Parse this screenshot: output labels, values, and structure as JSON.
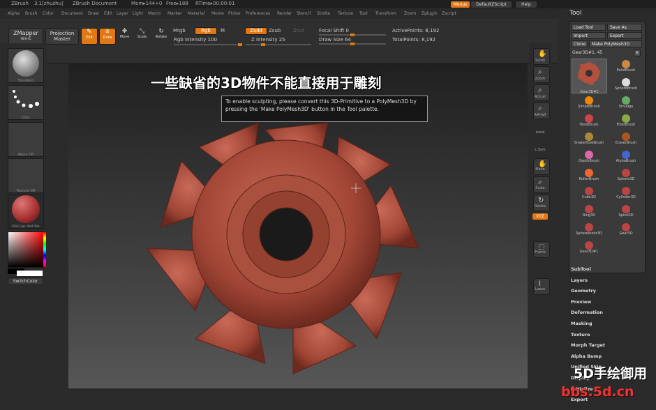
{
  "title_bar": {
    "app": "ZBrush",
    "version": "3.1[zhuzhu]",
    "doc": "ZBrush Document",
    "mem": "Mem▸144+0",
    "free": "Free▸188",
    "rtime": "RTime▸00:00:01",
    "menus_btn": "Menus",
    "script_btn": "DefaultZScript",
    "help_btn": "Help"
  },
  "menu_items": [
    "Alpha",
    "Brush",
    "Color",
    "Document",
    "Draw",
    "Edit",
    "Layer",
    "Light",
    "Macro",
    "Marker",
    "Material",
    "Movie",
    "Picker",
    "Preferences",
    "Render",
    "Stencil",
    "Stroke",
    "Texture",
    "Tool",
    "Transform",
    "Zoom",
    "Zplugin",
    "Zscript"
  ],
  "toolbar": {
    "zmapper": "ZMapper",
    "zmapper_sub": "rev-E",
    "projection": "Projection",
    "projection_sub": "Master",
    "edit": "Edit",
    "draw": "Draw",
    "move": "Move",
    "scale": "Scale",
    "rotate": "Rotate",
    "mrgb": "Mrgb",
    "rgb": "Rgb",
    "m": "M",
    "zadd": "Zadd",
    "zsub": "Zsub",
    "zcut": "Zcut",
    "rgb_intensity": "Rgb Intensity 100",
    "z_intensity": "Z Intensity 25",
    "focal_shift": "Focal Shift 0",
    "draw_size": "Draw Size 64",
    "active_points": "ActivePoints: 8,192",
    "total_points": "TotalPoints: 8,192"
  },
  "left_panel": [
    "Standard",
    "Dots",
    "Alpha Off",
    "Texture Off",
    "MatCap Red Wa"
  ],
  "switch_color": "SwitchColor",
  "viewport": {
    "overlay_title": "一些缺省的3D物件不能直接用于雕刻",
    "notice": "To enable sculpting, please convert this 3D-Primitive to a PolyMesh3D by pressing the 'Make PolyMesh3D' button in the Tool palette."
  },
  "right_strip": [
    "Scroll",
    "Zoom",
    "Actual",
    "AAHalf",
    "Local",
    "L.Sym",
    "Move",
    "Scale",
    "Rotate",
    "XYZ",
    "",
    "Frame",
    "",
    "Lasso"
  ],
  "tool_palette": {
    "title": "Tool",
    "load": "Load Tool",
    "save": "Save As",
    "import": "Import",
    "export": "Export",
    "clone": "Clone",
    "make_polymesh": "Make PolyMesh3D",
    "current": "Gear3D#1. 45",
    "r": "R",
    "current_thumb": "Gear3D#1",
    "brushes": [
      {
        "name": "PaintBrush",
        "color": "#c84"
      },
      {
        "name": "SphereBrush",
        "color": "#ddd"
      },
      {
        "name": "SimpleBrush",
        "color": "#e80"
      },
      {
        "name": "Smudge",
        "color": "#6a6"
      },
      {
        "name": "HookBrush",
        "color": "#c44"
      },
      {
        "name": "FiberBrush",
        "color": "#8a4"
      },
      {
        "name": "SnakeHookBrush",
        "color": "#a83"
      },
      {
        "name": "EraserBrush",
        "color": "#a52"
      },
      {
        "name": "DepthBrush",
        "color": "#d6a"
      },
      {
        "name": "AlphaBrush",
        "color": "#46c"
      },
      {
        "name": "RollerBrush",
        "color": "#e63"
      },
      {
        "name": "Sphere3D",
        "color": "#b44"
      },
      {
        "name": "Cube3D",
        "color": "#b44"
      },
      {
        "name": "Cylinder3D",
        "color": "#b44"
      },
      {
        "name": "Ring3D",
        "color": "#b44"
      },
      {
        "name": "Spiral3D",
        "color": "#b44"
      },
      {
        "name": "Sphereinder3D",
        "color": "#b44"
      },
      {
        "name": "Gear3D",
        "color": "#b44"
      },
      {
        "name": "Gear3D#1",
        "color": "#b44"
      }
    ],
    "subpalettes": [
      "SubTool",
      "Layers",
      "Geometry",
      "Preview",
      "Deformation",
      "Masking",
      "Texture",
      "Morph Target",
      "Alpha Bump",
      "Unified Skin",
      "Display",
      "Initialize",
      "Export"
    ]
  },
  "watermark": {
    "line1": "5D手绘御用",
    "line2": "bbs.5d.cn"
  }
}
